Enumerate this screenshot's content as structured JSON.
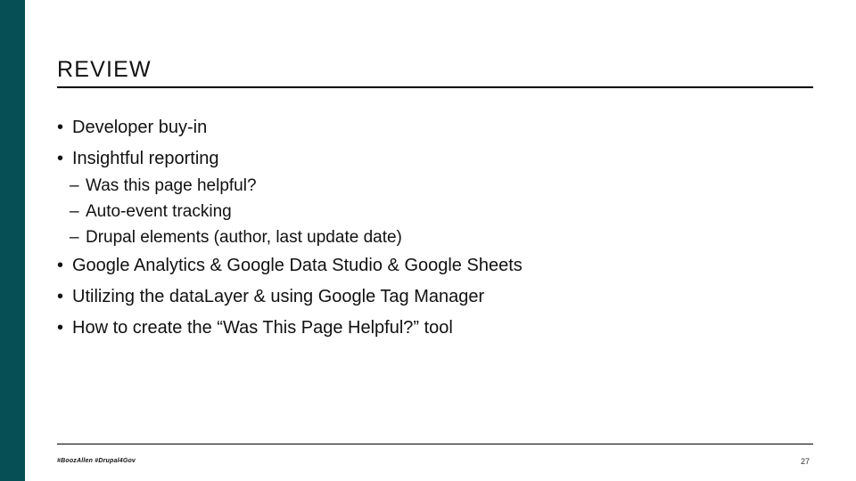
{
  "slide": {
    "title": "REVIEW",
    "page_number": "27",
    "accent_color": "#065055",
    "text_color": "#111111",
    "background_color": "#ffffff"
  },
  "footer": {
    "hashtags": "#BoozAllen #Drupal4Gov"
  },
  "content": {
    "bullets": [
      {
        "marker": "•",
        "text": "Developer buy-in"
      },
      {
        "marker": "•",
        "text": "Insightful reporting"
      },
      {
        "marker": "•",
        "text": "Google Analytics & Google Data Studio & Google Sheets"
      },
      {
        "marker": "•",
        "text": "Utilizing the dataLayer & using Google Tag Manager"
      },
      {
        "marker": "•",
        "text": "How to create the “Was This Page Helpful?” tool"
      }
    ],
    "sub_bullets": [
      {
        "marker": "–",
        "text": "Was this page helpful?"
      },
      {
        "marker": "–",
        "text": "Auto-event tracking"
      },
      {
        "marker": "–",
        "text": "Drupal elements (author, last update date)"
      }
    ]
  }
}
